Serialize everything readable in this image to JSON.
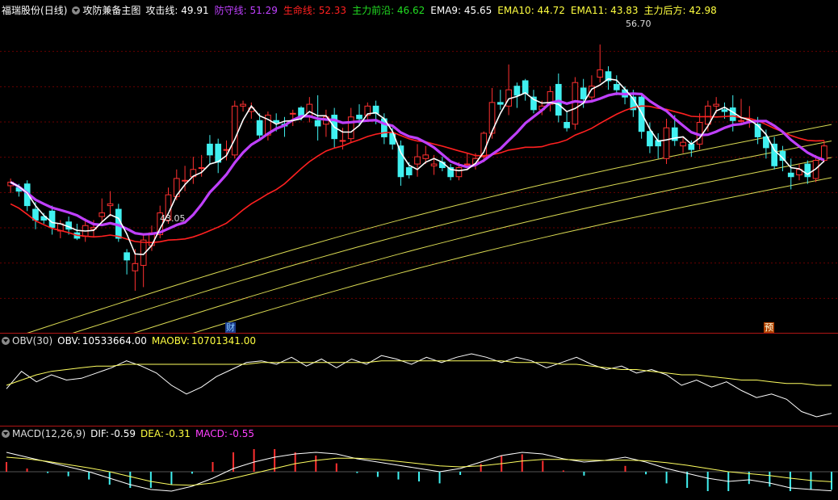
{
  "main_panel": {
    "stock_name": "福瑞股份",
    "period": "(日线)",
    "indicator_name": "攻防兼备主图",
    "indicators": [
      {
        "label": "攻击线:",
        "value": "49.91",
        "color": "#ffffff"
      },
      {
        "label": "防守线:",
        "value": "51.29",
        "color": "#c040ff"
      },
      {
        "label": "生命线:",
        "value": "52.33",
        "color": "#ff2020"
      },
      {
        "label": "主力前沿:",
        "value": "46.62",
        "color": "#22dd22"
      },
      {
        "label": "EMA9:",
        "value": "45.65",
        "color": "#ffffff"
      },
      {
        "label": "EMA10:",
        "value": "44.72",
        "color": "#ffff40"
      },
      {
        "label": "EMA11:",
        "value": "43.83",
        "color": "#ffff40"
      },
      {
        "label": "主力后方:",
        "value": "42.98",
        "color": "#ffff40"
      }
    ],
    "high_label": "56.70",
    "low_label": "43.05",
    "marker_cai": "财",
    "marker_yu": "预"
  },
  "obv_panel": {
    "title": "OBV(30)",
    "obv_label": "OBV:",
    "obv_value": "10533664.00",
    "maobv_label": "MAOBV:",
    "maobv_value": "10701341.00"
  },
  "macd_panel": {
    "title": "MACD(12,26,9)",
    "dif_label": "DIF:",
    "dif_value": "-0.59",
    "dea_label": "DEA:",
    "dea_value": "-0.31",
    "macd_label": "MACD:",
    "macd_value": "-0.55"
  },
  "colors": {
    "up": "#ff3030",
    "down": "#40f0f0",
    "fangshou": "#c040ff",
    "shengming": "#ff2020",
    "ema": "#ffff60",
    "grid": "#6a0000"
  },
  "chart_data": [
    {
      "type": "candlestick",
      "title": "攻防兼备主图",
      "ylim": [
        41,
        58
      ],
      "candles": [
        [
          48.9,
          49.1,
          48.5,
          49.3
        ],
        [
          48.8,
          48.6,
          48.3,
          49.0
        ],
        [
          49.0,
          47.8,
          47.5,
          49.2
        ],
        [
          47.6,
          47.0,
          46.5,
          48.0
        ],
        [
          47.2,
          47.0,
          46.8,
          47.4
        ],
        [
          47.5,
          46.6,
          46.2,
          47.8
        ],
        [
          46.4,
          46.8,
          46.0,
          47.0
        ],
        [
          46.9,
          46.5,
          46.2,
          47.2
        ],
        [
          46.3,
          46.0,
          45.9,
          46.8
        ],
        [
          46.1,
          46.7,
          45.8,
          47.1
        ],
        [
          46.5,
          46.6,
          46.1,
          47.0
        ],
        [
          47.2,
          47.4,
          46.9,
          48.2
        ],
        [
          47.8,
          47.9,
          47.2,
          48.6
        ],
        [
          47.6,
          46.0,
          45.8,
          47.9
        ],
        [
          45.2,
          44.8,
          44.0,
          45.4
        ],
        [
          44.2,
          44.6,
          43.1,
          45.4
        ],
        [
          44.5,
          45.9,
          43.3,
          46.2
        ],
        [
          45.6,
          46.3,
          45.3,
          46.7
        ],
        [
          46.2,
          47.4,
          46.0,
          47.8
        ],
        [
          47.0,
          48.4,
          46.8,
          48.8
        ],
        [
          48.3,
          49.3,
          48.1,
          49.8
        ],
        [
          49.2,
          49.2,
          48.6,
          50.0
        ],
        [
          49.4,
          49.8,
          49.0,
          50.5
        ],
        [
          49.9,
          49.9,
          49.4,
          50.6
        ],
        [
          51.2,
          50.6,
          50.1,
          51.7
        ],
        [
          51.2,
          50.2,
          49.6,
          51.5
        ],
        [
          50.9,
          50.9,
          50.3,
          51.4
        ],
        [
          50.6,
          53.3,
          50.4,
          53.6
        ],
        [
          53.3,
          53.4,
          53.0,
          53.6
        ],
        [
          53.0,
          53.2,
          52.6,
          53.5
        ],
        [
          52.5,
          51.7,
          51.4,
          52.9
        ],
        [
          51.7,
          52.8,
          51.4,
          53.0
        ],
        [
          52.5,
          52.4,
          51.9,
          52.9
        ],
        [
          52.3,
          52.2,
          51.6,
          52.7
        ],
        [
          52.9,
          52.9,
          52.2,
          53.1
        ],
        [
          53.2,
          52.7,
          52.5,
          53.3
        ],
        [
          52.7,
          53.4,
          52.4,
          53.8
        ],
        [
          52.5,
          52.2,
          51.4,
          53.9
        ],
        [
          52.3,
          52.7,
          51.6,
          53.1
        ],
        [
          52.8,
          51.5,
          51.0,
          53.2
        ],
        [
          51.4,
          51.4,
          50.9,
          52.1
        ],
        [
          51.5,
          52.7,
          51.3,
          53.2
        ],
        [
          52.8,
          52.6,
          52.2,
          53.4
        ],
        [
          52.8,
          53.3,
          52.5,
          53.5
        ],
        [
          53.3,
          52.9,
          52.3,
          53.6
        ],
        [
          52.6,
          51.6,
          51.2,
          52.9
        ],
        [
          51.8,
          51.2,
          50.9,
          52.1
        ],
        [
          51.1,
          49.4,
          48.9,
          51.4
        ],
        [
          49.9,
          49.5,
          49.3,
          50.2
        ],
        [
          50.1,
          50.5,
          49.4,
          51.2
        ],
        [
          50.4,
          50.6,
          50.1,
          51.1
        ],
        [
          50.0,
          50.1,
          49.5,
          50.6
        ],
        [
          50.2,
          49.9,
          49.7,
          50.5
        ],
        [
          49.9,
          49.4,
          49.2,
          50.1
        ],
        [
          49.4,
          49.9,
          49.2,
          50.2
        ],
        [
          50.1,
          50.1,
          49.9,
          50.7
        ],
        [
          50.1,
          50.4,
          49.8,
          50.7
        ],
        [
          50.5,
          51.8,
          50.2,
          51.9
        ],
        [
          51.8,
          53.5,
          51.5,
          54.3
        ],
        [
          53.5,
          53.4,
          53.1,
          54.2
        ],
        [
          53.3,
          54.2,
          52.8,
          55.6
        ],
        [
          54.4,
          53.9,
          53.2,
          54.6
        ],
        [
          54.7,
          54.0,
          53.6,
          54.8
        ],
        [
          53.8,
          53.1,
          52.9,
          54.2
        ],
        [
          53.1,
          53.3,
          52.8,
          53.6
        ],
        [
          53.4,
          54.1,
          53.0,
          54.4
        ],
        [
          54.5,
          52.8,
          52.4,
          55.1
        ],
        [
          52.4,
          52.1,
          51.9,
          53.0
        ],
        [
          52.3,
          54.6,
          52.0,
          54.9
        ],
        [
          54.3,
          53.7,
          53.2,
          54.8
        ],
        [
          53.8,
          54.4,
          53.6,
          55.0
        ],
        [
          54.9,
          55.3,
          54.6,
          56.7
        ],
        [
          55.2,
          54.7,
          54.2,
          55.5
        ],
        [
          54.5,
          54.2,
          53.9,
          55.0
        ],
        [
          54.2,
          53.8,
          53.4,
          54.4
        ],
        [
          53.8,
          53.1,
          52.7,
          54.2
        ],
        [
          53.8,
          51.9,
          51.5,
          54.0
        ],
        [
          51.9,
          51.1,
          50.7,
          52.4
        ],
        [
          51.4,
          51.1,
          50.4,
          51.8
        ],
        [
          50.4,
          52.1,
          50.1,
          52.6
        ],
        [
          52.1,
          51.4,
          51.1,
          52.8
        ],
        [
          51.1,
          51.3,
          50.7,
          51.6
        ],
        [
          51.2,
          50.9,
          50.5,
          51.4
        ],
        [
          51.2,
          52.4,
          50.9,
          52.9
        ],
        [
          52.3,
          53.3,
          51.9,
          53.6
        ],
        [
          53.3,
          53.4,
          52.9,
          53.8
        ],
        [
          53.1,
          53.0,
          52.6,
          53.5
        ],
        [
          53.2,
          52.5,
          51.9,
          53.9
        ],
        [
          52.5,
          52.5,
          52.3,
          53.7
        ],
        [
          52.5,
          52.6,
          52.1,
          53.3
        ],
        [
          52.3,
          51.6,
          51.2,
          52.7
        ],
        [
          51.6,
          51.0,
          50.4,
          52.0
        ],
        [
          51.2,
          50.0,
          49.8,
          51.6
        ],
        [
          50.8,
          50.3,
          49.7,
          51.1
        ],
        [
          49.6,
          49.4,
          48.7,
          50.4
        ],
        [
          49.5,
          49.8,
          49.2,
          50.1
        ],
        [
          50.1,
          49.4,
          49.0,
          50.3
        ],
        [
          49.3,
          50.3,
          49.1,
          50.6
        ],
        [
          50.3,
          51.1,
          50.2,
          51.4
        ]
      ],
      "ema_lines_start": [
        44.4,
        43.9,
        43.1,
        42.4
      ],
      "ema_lines_end": [
        56.3,
        55.7,
        55.1,
        54.3
      ]
    },
    {
      "type": "line",
      "title": "OBV(30)",
      "series": [
        {
          "name": "OBV",
          "values": [
            10.68,
            10.78,
            10.72,
            10.76,
            10.73,
            10.74,
            10.77,
            10.8,
            10.84,
            10.81,
            10.77,
            10.7,
            10.65,
            10.69,
            10.75,
            10.79,
            10.83,
            10.84,
            10.82,
            10.86,
            10.81,
            10.85,
            10.8,
            10.85,
            10.82,
            10.87,
            10.85,
            10.82,
            10.86,
            10.83,
            10.86,
            10.88,
            10.86,
            10.83,
            10.86,
            10.84,
            10.8,
            10.83,
            10.86,
            10.82,
            10.79,
            10.81,
            10.77,
            10.79,
            10.76,
            10.7,
            10.73,
            10.69,
            10.72,
            10.67,
            10.63,
            10.65,
            10.62,
            10.55,
            10.52,
            10.54
          ]
        },
        {
          "name": "MAOBV",
          "values": [
            10.7,
            10.73,
            10.76,
            10.78,
            10.79,
            10.8,
            10.81,
            10.81,
            10.82,
            10.82,
            10.82,
            10.82,
            10.82,
            10.82,
            10.82,
            10.82,
            10.82,
            10.83,
            10.83,
            10.83,
            10.83,
            10.83,
            10.83,
            10.83,
            10.83,
            10.84,
            10.84,
            10.84,
            10.84,
            10.84,
            10.84,
            10.84,
            10.84,
            10.84,
            10.83,
            10.83,
            10.83,
            10.82,
            10.82,
            10.81,
            10.8,
            10.79,
            10.79,
            10.78,
            10.77,
            10.76,
            10.76,
            10.75,
            10.74,
            10.73,
            10.73,
            10.72,
            10.71,
            10.71,
            10.7,
            10.7
          ]
        }
      ]
    },
    {
      "type": "bar",
      "title": "MACD(12,26,9)",
      "series": [
        {
          "name": "DIF",
          "values": [
            0.6,
            0.45,
            0.3,
            0.15,
            0.0,
            -0.2,
            -0.4,
            -0.55,
            -0.6,
            -0.45,
            -0.2,
            0.1,
            0.3,
            0.45,
            0.55,
            0.6,
            0.55,
            0.4,
            0.3,
            0.2,
            0.1,
            0.0,
            0.1,
            0.3,
            0.5,
            0.6,
            0.55,
            0.4,
            0.3,
            0.35,
            0.45,
            0.3,
            0.1,
            -0.05,
            -0.2,
            -0.3,
            -0.25,
            -0.35,
            -0.5,
            -0.55,
            -0.59
          ]
        },
        {
          "name": "DEA",
          "values": [
            0.45,
            0.4,
            0.32,
            0.22,
            0.12,
            0.0,
            -0.15,
            -0.3,
            -0.4,
            -0.42,
            -0.35,
            -0.2,
            -0.05,
            0.1,
            0.25,
            0.35,
            0.42,
            0.42,
            0.38,
            0.32,
            0.25,
            0.18,
            0.15,
            0.18,
            0.25,
            0.33,
            0.38,
            0.38,
            0.36,
            0.35,
            0.36,
            0.34,
            0.28,
            0.2,
            0.1,
            0.0,
            -0.06,
            -0.12,
            -0.2,
            -0.27,
            -0.31
          ]
        }
      ]
    }
  ]
}
